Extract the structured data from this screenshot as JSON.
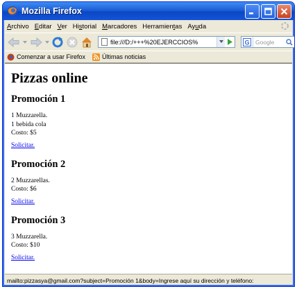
{
  "window": {
    "title": "Mozilla Firefox"
  },
  "menu": [
    {
      "pre": "",
      "ul": "A",
      "post": "rchivo"
    },
    {
      "pre": "",
      "ul": "E",
      "post": "ditar"
    },
    {
      "pre": "",
      "ul": "V",
      "post": "er"
    },
    {
      "pre": "Hi",
      "ul": "s",
      "post": "torial"
    },
    {
      "pre": "",
      "ul": "M",
      "post": "arcadores"
    },
    {
      "pre": "Herramien",
      "ul": "t",
      "post": "as"
    },
    {
      "pre": "Ay",
      "ul": "u",
      "post": "da"
    }
  ],
  "nav": {
    "url": "file:///D:/+++%20EJERCCIOS%",
    "search_placeholder": "Google"
  },
  "bookmarks": [
    {
      "label": "Comenzar a usar Firefox",
      "icon": "firefox-icon"
    },
    {
      "label": "Últimas noticias",
      "icon": "rss-icon"
    }
  ],
  "page": {
    "title": "Pizzas online",
    "promos": [
      {
        "heading": "Promoción 1",
        "lines": [
          "1 Muzzarella.",
          "1 bebida cola",
          "Costo: $5"
        ],
        "link": "Solicitar."
      },
      {
        "heading": "Promoción 2",
        "lines": [
          "2 Muzzarellas.",
          "Costo: $6"
        ],
        "link": "Solicitar."
      },
      {
        "heading": "Promoción 3",
        "lines": [
          "3 Muzzarella.",
          "Costo: $10"
        ],
        "link": "Solicitar."
      }
    ]
  },
  "status": "mailto:pizzasya@gmail.com?subject=Promoción 1&body=Ingrese aquí su dirección y teléfono:",
  "colors": {
    "titlebar": "#1d5fd6",
    "link": "#0000ee",
    "chrome": "#ece9d8"
  }
}
